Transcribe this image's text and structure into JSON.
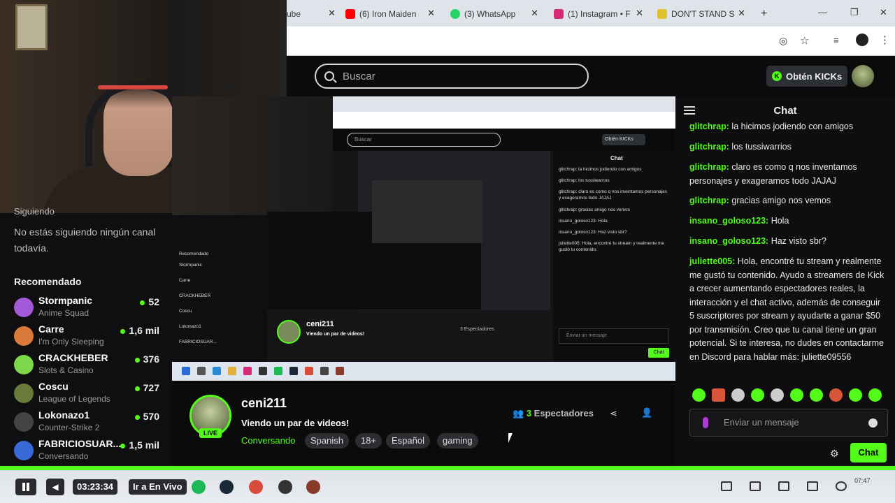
{
  "browser": {
    "tabs": [
      {
        "label": "ube",
        "icon": "youtube-icon",
        "color": "#ff0000"
      },
      {
        "label": "(6) Iron Maiden",
        "icon": "youtube-icon",
        "color": "#ff0000"
      },
      {
        "label": "(3) WhatsApp",
        "icon": "whatsapp-icon",
        "color": "#25d366"
      },
      {
        "label": "(1) Instagram • F",
        "icon": "instagram-icon",
        "color": "#d62976"
      },
      {
        "label": "DON'T STAND S",
        "icon": "star-icon",
        "color": "#e0c22e"
      }
    ],
    "new_tab": "+"
  },
  "header": {
    "search_placeholder": "Buscar",
    "kicks_label": "Obtén KICKs"
  },
  "sidebar": {
    "following_title": "Siguiendo",
    "no_following": "No estás siguiendo ningún canal todavía.",
    "recommended_title": "Recomendado",
    "channels": [
      {
        "name": "Stormpanic",
        "category": "Anime Squad",
        "viewers": "52",
        "color": "#a35ad8"
      },
      {
        "name": "Carre",
        "category": "I'm Only Sleeping",
        "viewers": "1,6 mil",
        "color": "#d87a3a"
      },
      {
        "name": "CRACKHEBER",
        "category": "Slots & Casino",
        "viewers": "376",
        "color": "#7ad84a"
      },
      {
        "name": "Coscu",
        "category": "League of Legends",
        "viewers": "727",
        "color": "#6a7a3a"
      },
      {
        "name": "Lokonazo1",
        "category": "Counter-Strike 2",
        "viewers": "570",
        "color": "#444444"
      },
      {
        "name": "FABRICIOSUAR...",
        "category": "Conversando",
        "viewers": "1,5 mil",
        "color": "#3a6ad8"
      }
    ]
  },
  "capture": {
    "search": "Buscar",
    "kicks": "Obtén KICKs",
    "chat_title": "Chat",
    "chat_lines": [
      "glitchrap: la hicimos jodiendo con amigos",
      "glitchrap: los tussiwarrios",
      "glitchrap: claro es como q nos inventamos personajes y exageramos todo JAJAJ",
      "glitchrap: gracias amigo nos vemos",
      "insano_goloso123: Hola",
      "insano_goloso123: Haz visto sbr?",
      "juliette005: Hola, encontré tu stream y realmente me gustó tu contenido."
    ],
    "channel": "ceni211",
    "title": "Viendo un par de videos!",
    "viewers": "3 Espectadores",
    "chat_placeholder": "Enviar un mensaje",
    "chat_button": "Chat"
  },
  "chat": {
    "title": "Chat",
    "messages": [
      {
        "user": "glitchrap:",
        "text": " la hicimos jodiendo con amigos"
      },
      {
        "user": "glitchrap:",
        "text": " los tussiwarrios"
      },
      {
        "user": "glitchrap:",
        "text": " claro es como q nos inventamos personajes y exageramos todo JAJAJ"
      },
      {
        "user": "glitchrap:",
        "text": " gracias amigo nos vemos"
      },
      {
        "user": "insano_goloso123:",
        "text": " Hola"
      },
      {
        "user": "insano_goloso123:",
        "text": " Haz visto sbr?"
      },
      {
        "user": "juliette005:",
        "text": " Hola, encontré tu stream y realmente me gustó tu contenido. Ayudo a streamers de Kick a crecer aumentando espectadores reales, la interacción y el chat activo, además de conseguir 5 suscriptores por stream y ayudarte a ganar $50 por transmisión. Creo que tu canal tiene un gran potencial. Si te interesa, no dudes en contactarme en Discord para hablar más: juliette09556"
      }
    ],
    "emote_colors": [
      "#53fc18",
      "#d8553a",
      "#cccccc",
      "#53fc18",
      "#cccccc",
      "#53fc18",
      "#53fc18",
      "#d8553a",
      "#53fc18",
      "#53fc18"
    ],
    "input_placeholder": "Enviar un mensaje",
    "send_label": "Chat"
  },
  "profile": {
    "channel": "ceni211",
    "live": "LIVE",
    "stream_title": "Viendo un par de videos!",
    "category": "Conversando",
    "tags": [
      "Spanish",
      "18+",
      "Español",
      "gaming"
    ],
    "viewers_count": "3",
    "viewers_label": " Espectadores"
  },
  "player": {
    "time": "03:23:34",
    "go_live": "Ir a En Vivo",
    "progress": 1.0,
    "clock": "07:47"
  }
}
